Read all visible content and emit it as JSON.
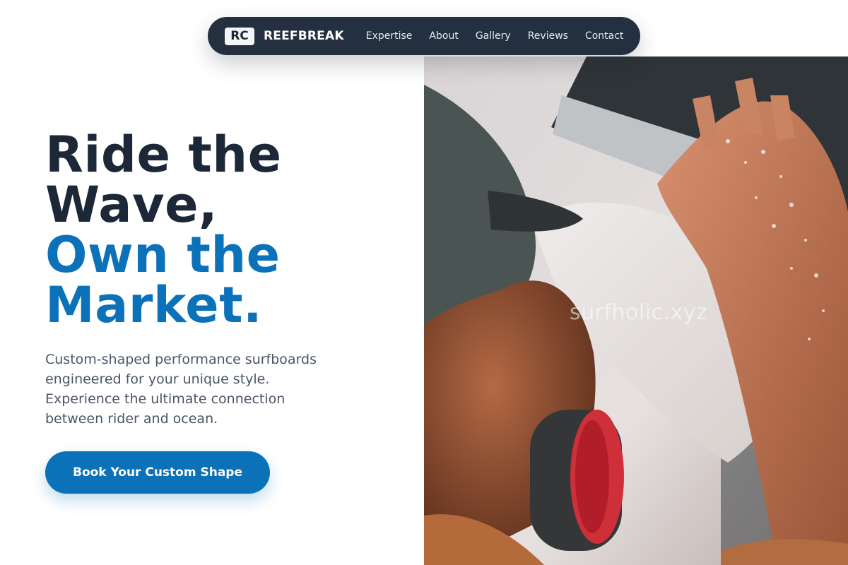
{
  "nav": {
    "logo_badge": "RC",
    "brand_name": "REEFBREAK",
    "links": [
      "Expertise",
      "About",
      "Gallery",
      "Reviews",
      "Contact"
    ]
  },
  "hero": {
    "headline_line1": "Ride the",
    "headline_line2": "Wave,",
    "headline_line3": "Own the",
    "headline_line4": "Market.",
    "description": "Custom-shaped performance surfboards engineered for your unique style. Experience the ultimate connection between rider and ocean.",
    "cta_label": "Book Your Custom Shape"
  },
  "photo": {
    "watermark": "surfholic.xyz",
    "subject": "shaper-sanding-surfboard"
  },
  "colors": {
    "nav_bg": "#24303f",
    "heading_dark": "#1c2737",
    "accent_blue": "#0b72b9",
    "body_text": "#4a5566"
  }
}
